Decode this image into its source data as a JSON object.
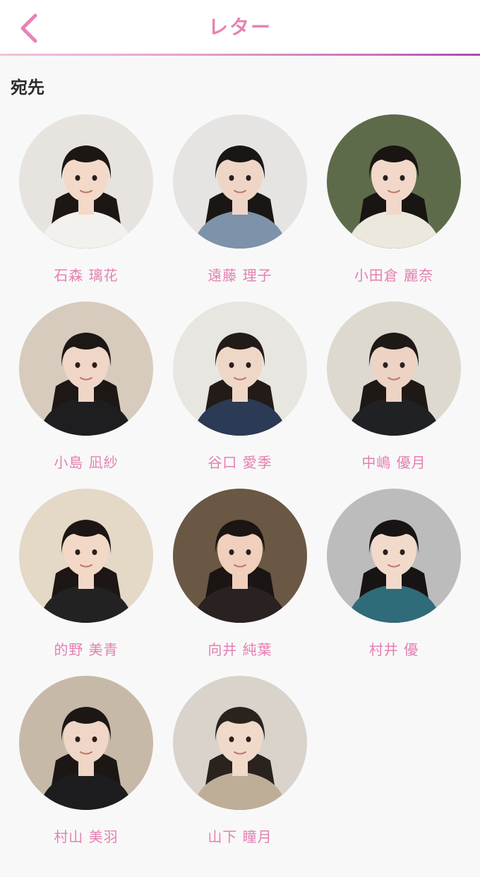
{
  "header": {
    "title": "レター",
    "back_icon": "chevron-left-icon",
    "accent": "#e882b4"
  },
  "section": {
    "title": "宛先"
  },
  "members": [
    {
      "name": "石森 璃花",
      "bg": "#e7e4e0",
      "hair": "#1c1714",
      "skin": "#f2d9c8",
      "top": "#f3f1ee"
    },
    {
      "name": "遠藤 理子",
      "bg": "#e6e4e2",
      "hair": "#1a1614",
      "skin": "#efd5c6",
      "top": "#7d93aa"
    },
    {
      "name": "小田倉 麗奈",
      "bg": "#5d6b4a",
      "hair": "#191513",
      "skin": "#f1d8c9",
      "top": "#ece8de"
    },
    {
      "name": "小島 凪紗",
      "bg": "#d7cbbd",
      "hair": "#1d1715",
      "skin": "#f0d6c6",
      "top": "#1e1e20"
    },
    {
      "name": "谷口 愛季",
      "bg": "#e8e6e1",
      "hair": "#221b17",
      "skin": "#efd7c7",
      "top": "#2b3a55"
    },
    {
      "name": "中嶋 優月",
      "bg": "#ded9cf",
      "hair": "#1e1917",
      "skin": "#ecd3c4",
      "top": "#202124"
    },
    {
      "name": "的野 美青",
      "bg": "#e4d8c6",
      "hair": "#1c1614",
      "skin": "#f3d8c7",
      "top": "#222222"
    },
    {
      "name": "向井 純葉",
      "bg": "#6a5845",
      "hair": "#1b1513",
      "skin": "#f0cfbd",
      "top": "#2a2220"
    },
    {
      "name": "村井 優",
      "bg": "#bdbcbc",
      "hair": "#181413",
      "skin": "#f2dacb",
      "top": "#2f6b78"
    },
    {
      "name": "村山 美羽",
      "bg": "#c7b9a8",
      "hair": "#1c1715",
      "skin": "#efd6c7",
      "top": "#1d1d1f"
    },
    {
      "name": "山下 瞳月",
      "bg": "#d9d3cb",
      "hair": "#2a221d",
      "skin": "#f1d9ca",
      "top": "#bfae97"
    }
  ]
}
